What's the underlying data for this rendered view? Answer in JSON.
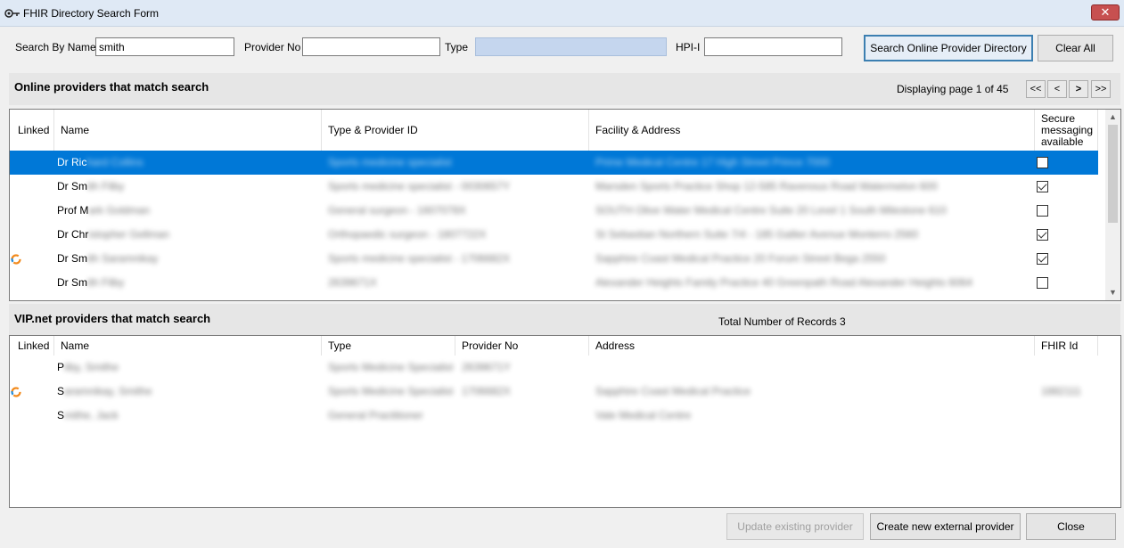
{
  "window": {
    "title": "FHIR Directory Search Form",
    "close_glyph": "✕"
  },
  "search": {
    "name_label": "Search By Name",
    "name_value": "smith",
    "provider_no_label": "Provider No",
    "provider_no_value": "",
    "type_label": "Type",
    "type_value": "",
    "hpii_label": "HPI-I",
    "hpii_value": "",
    "search_button": "Search Online Provider Directory",
    "clear_button": "Clear All"
  },
  "online": {
    "title": "Online providers that match search",
    "pager_text": "Displaying page 1 of 45",
    "pager": {
      "first": "<<",
      "prev": "<",
      "next": ">",
      "last": ">>"
    },
    "columns": {
      "linked": "Linked",
      "name": "Name",
      "type_id": "Type & Provider ID",
      "facility": "Facility & Address",
      "secure": "Secure messaging available"
    },
    "rows": [
      {
        "linked": false,
        "name": "Dr Ric",
        "name_hidden": "hard Collins",
        "type_id": "Sports medicine specialist",
        "facility": "Prime Medical Centre 17 High Street Prince 7000",
        "secure": false,
        "selected": true
      },
      {
        "linked": false,
        "name": "Dr Sm",
        "name_hidden": "ith Filby",
        "type_id": "Sports medicine specialist - 0030657Y",
        "facility": "Marsden Sports Practice Shop 12-585 Ravenous Road Watermelon 600",
        "secure": true,
        "selected": false
      },
      {
        "linked": false,
        "name": "Prof M",
        "name_hidden": "ark Goldman",
        "type_id": "General surgeon - 1607078X",
        "facility": "SOUTH Olive Water Medical Centre Suite 20 Level 1 South Milestone 610",
        "secure": false,
        "selected": false
      },
      {
        "linked": false,
        "name": "Dr Chr",
        "name_hidden": "istopher Gellman",
        "type_id": "Orthopaedic surgeon - 1807722X",
        "facility": "St Sebastian Northern Suite 7/4 - 185 Gallier Avenue Monterro 2560",
        "secure": true,
        "selected": false
      },
      {
        "linked": true,
        "name": "Dr Sm",
        "name_hidden": "ith Saramnikay",
        "type_id": "Sports medicine specialist - 1706682X",
        "facility": "Sapphire Coast Medical Practice 20 Forum Street Bega 2550",
        "secure": true,
        "selected": false
      },
      {
        "linked": false,
        "name": "Dr Sm",
        "name_hidden": "ith Filby",
        "type_id": "2639671X",
        "facility": "Alexander Heights Family Practice 40 Greenpath Road Alexander Heights 6064",
        "secure": false,
        "selected": false
      }
    ]
  },
  "vip": {
    "title": "VIP.net providers that match search",
    "total_text": "Total Number of Records 3",
    "columns": {
      "linked": "Linked",
      "name": "Name",
      "type": "Type",
      "provider_no": "Provider No",
      "address": "Address",
      "fhir_id": "FHIR Id"
    },
    "rows": [
      {
        "linked": false,
        "name": "P",
        "name_hidden": "ilby, Smithe",
        "type": "Sports Medicine Specialist",
        "provider_no": "2639671Y",
        "address": "",
        "fhir_id": ""
      },
      {
        "linked": true,
        "name": "S",
        "name_hidden": "aramnikay, Smithe",
        "type": "Sports Medicine Specialist",
        "provider_no": "1706682X",
        "address": "Sapphire Coast Medical Practice",
        "fhir_id": "1882111"
      },
      {
        "linked": false,
        "name": "S",
        "name_hidden": "mithe, Jack",
        "type": "General Practitioner",
        "provider_no": "",
        "address": "Vale Medical Centre",
        "fhir_id": ""
      }
    ]
  },
  "footer": {
    "update_button": "Update existing provider",
    "create_button": "Create new external provider",
    "close_button": "Close"
  },
  "icons": {
    "app": "app-gear-key-icon",
    "linked": "linked-ring-icon",
    "scroll_up": "chevron-up-icon",
    "scroll_down": "chevron-down-icon"
  },
  "colors": {
    "selection": "#0078d7",
    "linked_ring": "#f28a1c",
    "linked_ring_alt": "#1e88d6",
    "title_bar": "#dfe9f5"
  }
}
